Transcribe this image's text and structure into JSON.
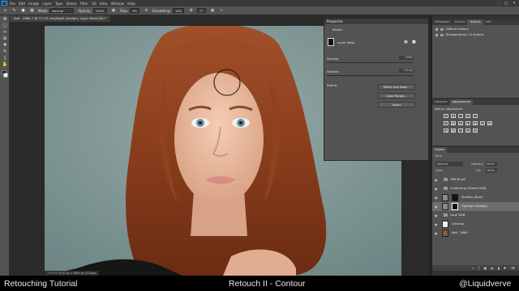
{
  "menu": {
    "logo": "Ps",
    "items": [
      "File",
      "Edit",
      "Image",
      "Layer",
      "Type",
      "Select",
      "Filter",
      "3D",
      "View",
      "Window",
      "Help"
    ]
  },
  "options": {
    "mode_label": "Mode:",
    "mode_value": "Normal",
    "opacity_label": "Opacity:",
    "opacity_value": "100%",
    "flow_label": "Flow:",
    "flow_value": "3%",
    "smoothing_label": "Smoothing:",
    "smoothing_value": "10%",
    "angle_value": "0°"
  },
  "document": {
    "tab_title": "Kafi - 2884-1 @ 71.1% (Highlight (Dodge), Layer Mask/16) *",
    "status": "71.07%  5520 px x 3680 px (300ppi)"
  },
  "properties": {
    "title": "Properties",
    "masks_label": "Masks",
    "layer_mask_label": "Layer Mask",
    "density_label": "Density:",
    "density_value": "100%",
    "feather_label": "Feather:",
    "feather_value": "0.0 px",
    "refine_label": "Refine:",
    "select_mask_button": "Select and Mask...",
    "color_range_button": "Color Range...",
    "invert_button": "Invert"
  },
  "right_top_tabs": [
    "Histogram",
    "History",
    "Actions",
    "Info"
  ],
  "right_top_active": "Actions",
  "actions": [
    {
      "label": "Default Actions"
    },
    {
      "label": "Bluepainterna 2.0 Actions"
    }
  ],
  "adjust_tabs": [
    "Libraries",
    "Adjustments"
  ],
  "adjust_active": "Adjustments",
  "adjust_hint": "Add an adjustment",
  "adjust_icons": [
    "brightness-icon",
    "levels-icon",
    "curves-icon",
    "exposure-icon",
    "triangle-icon",
    "vibrance-icon",
    "hue-sat-icon",
    "color-balance-icon",
    "bw-icon",
    "photo-filter-icon",
    "channel-mixer-icon",
    "lookup-icon",
    "invert-icon",
    "posterize-icon",
    "threshold-icon",
    "selective-color-icon",
    "gradient-map-icon"
  ],
  "layers": {
    "tab": "Layers",
    "filter_label": "Kind",
    "blend_mode": "Normal",
    "opacity_label": "Opacity:",
    "opacity_value": "100%",
    "lock_label": "Lock:",
    "fill_label": "Fill:",
    "fill_value": "100%",
    "rows": [
      {
        "name": "ONE Brush",
        "type": "folder"
      },
      {
        "name": "Contouring (Global D&B)",
        "type": "folder"
      },
      {
        "name": "Shadow (Burn)",
        "type": "mask"
      },
      {
        "name": "Highlight (Dodge)",
        "type": "mask",
        "selected": true
      },
      {
        "name": "Local D&B",
        "type": "folder"
      },
      {
        "name": "Cleanup",
        "type": "layer"
      },
      {
        "name": "Kafi - 2884",
        "type": "photo"
      }
    ]
  },
  "footer": {
    "left": "Retouching Tutorial",
    "center": "Retouch II - Contour",
    "right": "@Liquidverve"
  }
}
